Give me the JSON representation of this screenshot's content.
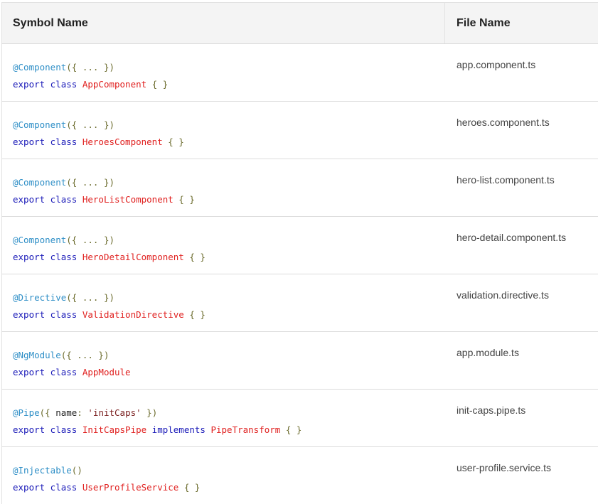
{
  "header": {
    "symbol_name": "Symbol Name",
    "file_name": "File Name"
  },
  "rows": [
    {
      "decorator": "@Component",
      "args": "({ ... })",
      "line2_prefix": "export class ",
      "class_name": "AppComponent",
      "line2_suffix": " { }",
      "file": "app.component.ts"
    },
    {
      "decorator": "@Component",
      "args": "({ ... })",
      "line2_prefix": "export class ",
      "class_name": "HeroesComponent",
      "line2_suffix": " { }",
      "file": "heroes.component.ts"
    },
    {
      "decorator": "@Component",
      "args": "({ ... })",
      "line2_prefix": "export class ",
      "class_name": "HeroListComponent",
      "line2_suffix": " { }",
      "file": "hero-list.component.ts"
    },
    {
      "decorator": "@Component",
      "args": "({ ... })",
      "line2_prefix": "export class ",
      "class_name": "HeroDetailComponent",
      "line2_suffix": " { }",
      "file": "hero-detail.component.ts"
    },
    {
      "decorator": "@Directive",
      "args": "({ ... })",
      "line2_prefix": "export class ",
      "class_name": "ValidationDirective",
      "line2_suffix": " { }",
      "file": "validation.directive.ts"
    },
    {
      "decorator": "@NgModule",
      "args": "({ ... })",
      "line2_prefix": "export class ",
      "class_name": "AppModule",
      "line2_suffix": "",
      "file": "app.module.ts"
    },
    {
      "decorator": "@Pipe",
      "args_open": "({ ",
      "param": "name",
      "colon": ": ",
      "string": "'initCaps'",
      "args_close": " })",
      "line2_prefix": "export class ",
      "class_name": "InitCapsPipe",
      "implements": " implements ",
      "interface": "PipeTransform",
      "line2_suffix": " { }",
      "file": "init-caps.pipe.ts"
    },
    {
      "decorator": "@Injectable",
      "args": "()",
      "line2_prefix": "export class ",
      "class_name": "UserProfileService",
      "line2_suffix": " { }",
      "file": "user-profile.service.ts"
    }
  ]
}
